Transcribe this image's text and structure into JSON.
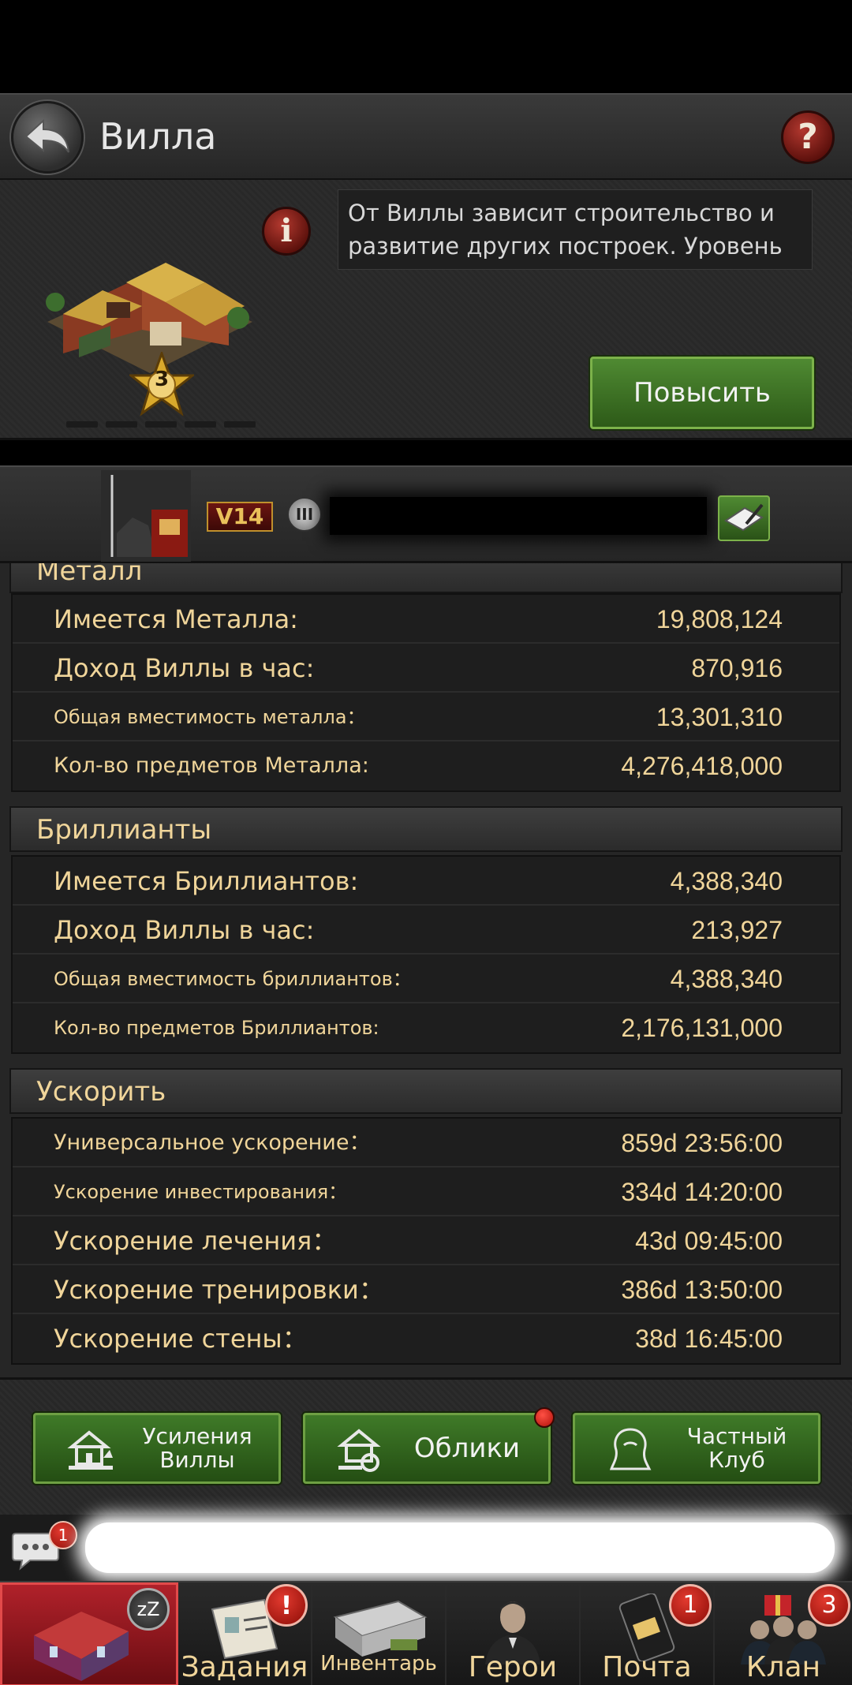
{
  "header": {
    "title": "Вилла",
    "help_label": "?"
  },
  "building": {
    "level": "3",
    "info_label": "i",
    "description": "От Виллы зависит строительство и развитие других построек. Уровень Виллы ограничивает уровни всех",
    "upgrade_label": "Повысить"
  },
  "player": {
    "vip": "V14",
    "rank": "III"
  },
  "sections": {
    "metal": {
      "title": "Металл",
      "rows": [
        {
          "label": "Имеется Металла:",
          "value": "19,808,124"
        },
        {
          "label": "Доход Виллы в час:",
          "value": "870,916"
        },
        {
          "label": "Общая вместимость металла：",
          "value": "13,301,310"
        },
        {
          "label": "Кол-во предметов Металла:",
          "value": "4,276,418,000"
        }
      ]
    },
    "diamonds": {
      "title": "Бриллианты",
      "rows": [
        {
          "label": "Имеется Бриллиантов:",
          "value": "4,388,340"
        },
        {
          "label": "Доход Виллы в час:",
          "value": "213,927"
        },
        {
          "label": "Общая вместимость бриллиантов：",
          "value": "4,388,340"
        },
        {
          "label": "Кол-во предметов Бриллиантов:",
          "value": "2,176,131,000"
        }
      ]
    },
    "speedup": {
      "title": "Ускорить",
      "rows": [
        {
          "label": "Универсальное ускорение：",
          "value": "859d 23:56:00"
        },
        {
          "label": "Ускорение инвестирования：",
          "value": "334d 14:20:00"
        },
        {
          "label": "Ускорение лечения：",
          "value": "43d 09:45:00"
        },
        {
          "label": "Ускорение тренировки：",
          "value": "386d 13:50:00"
        },
        {
          "label": "Ускорение стены：",
          "value": "38d 16:45:00"
        }
      ]
    }
  },
  "actions": {
    "boosts": {
      "line1": "Усиления",
      "line2": "Виллы"
    },
    "skins": {
      "label": "Облики"
    },
    "club": {
      "line1": "Частный",
      "line2": "Клуб"
    }
  },
  "chat": {
    "badge": "1"
  },
  "nav": {
    "villa": {
      "label": "",
      "badge": "zZ"
    },
    "quests": {
      "label": "Задания",
      "badge": "!"
    },
    "inventory": {
      "label": "Инвентарь"
    },
    "heroes": {
      "label": "Герои"
    },
    "mail": {
      "label": "Почта",
      "badge": "1"
    },
    "clan": {
      "label": "Клан",
      "badge": "3"
    }
  },
  "colors": {
    "accent_gold": "#f0d59a",
    "button_green": "#3f7a28",
    "badge_red": "#c2180f"
  }
}
